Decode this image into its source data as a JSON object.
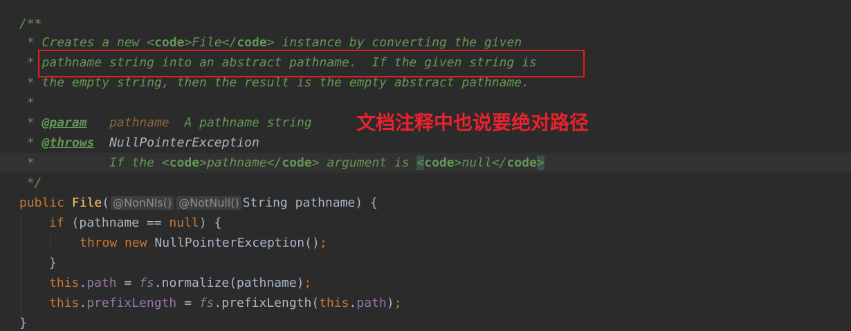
{
  "editor": {
    "lines": {
      "l1": {
        "text": "/**"
      },
      "l2": {
        "star": " * ",
        "a": "Creates a new ",
        "t1o": "<",
        "t1n": "code",
        "t1c": ">",
        "b": "File",
        "t2o": "</",
        "t2n": "code",
        "t2c": ">",
        "c": " instance by converting the given"
      },
      "l3": {
        "star": " * ",
        "text": "pathname string into an abstract pathname.  If the given string is"
      },
      "l4": {
        "star": " * ",
        "text": "the empty string, then the result is the empty abstract pathname."
      },
      "l5": {
        "text": " *"
      },
      "l6": {
        "star": " * ",
        "tag": "@param",
        "gap": "   ",
        "name": "pathname",
        "desc": "  A pathname string"
      },
      "l7": {
        "star": " * ",
        "tag": "@throws",
        "gap": "  ",
        "exc": "NullPointerException"
      },
      "l8": {
        "star": " *          ",
        "a": "If the ",
        "t1o": "<",
        "t1n": "code",
        "t1c": ">",
        "b": "pathname",
        "t2o": "</",
        "t2n": "code",
        "t2c": ">",
        "c": " argument is ",
        "t3o": "<",
        "t3n": "code",
        "t3c": ">",
        "d": "null",
        "t4o": "</",
        "t4n": "code",
        "t4c": ">"
      },
      "l9": {
        "text": " */"
      },
      "l10": {
        "kw": "public ",
        "fn": "File",
        "paren": "(",
        "ann1": "@NonNls()",
        "ann2": "@NotNull()",
        "rest": "String pathname) {"
      },
      "l11": {
        "kw": "if",
        "a": " (pathname == ",
        "null": "null",
        "b": ") {"
      },
      "l12": {
        "kw1": "throw ",
        "kw2": "new ",
        "a": "NullPointerException()",
        "semi": ";"
      },
      "l13": {
        "text": "}"
      },
      "l14": {
        "kw": "this",
        "dot": ".",
        "field": "path",
        "a": " = ",
        "fs": "fs",
        "b": ".normalize(pathname)",
        "semi": ";"
      },
      "l15": {
        "kw": "this",
        "dot": ".",
        "field": "prefixLength",
        "a": " = ",
        "fs": "fs",
        "b": ".prefixLength(",
        "kw2": "this",
        "dot2": ".",
        "field2": "path",
        "c": ")",
        "semi": ";"
      },
      "l16": {
        "text": "}"
      }
    }
  },
  "annotation": {
    "note": "文档注释中也说要绝对路径",
    "color": "#e8232d"
  },
  "colors": {
    "background": "#2b2b2b",
    "doc_comment": "#629755",
    "keyword": "#cc7832",
    "method": "#ffc66d",
    "field": "#9876aa",
    "text": "#a9b7c6"
  }
}
